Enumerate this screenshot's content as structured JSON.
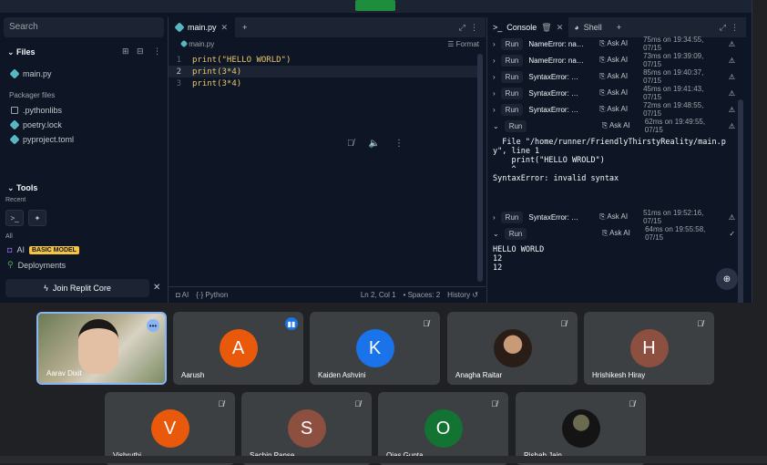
{
  "sidebar": {
    "search_placeholder": "Search",
    "files_title": "Files",
    "files": [
      "main.py"
    ],
    "packager_title": "Packager files",
    "packager_files": [
      ".pythonlibs",
      "poetry.lock",
      "pyproject.toml"
    ],
    "tools_title": "Tools",
    "recent_label": "Recent",
    "all_label": "All",
    "ai_label": "AI",
    "ai_badge": "BASIC MODEL",
    "deployments_label": "Deployments",
    "join_label": "Join Replit Core"
  },
  "editor": {
    "tab_label": "main.py",
    "crumb": "main.py",
    "format_label": "Format",
    "lines": [
      {
        "num": "1",
        "text": "print(\"HELLO WORLD\")"
      },
      {
        "num": "2",
        "text": "print(3*4)"
      },
      {
        "num": "3",
        "text": "print(3*4)"
      }
    ],
    "status": {
      "ai": "AI",
      "lang": "Python",
      "position": "Ln 2, Col 1",
      "spaces": "Spaces: 2",
      "history": "History"
    }
  },
  "console": {
    "tab_console": "Console",
    "tab_shell": "Shell",
    "runs": [
      {
        "err": "NameError: na…",
        "time": "75ms on 19:34:55, 07/15",
        "status": "⚠"
      },
      {
        "err": "NameError: na…",
        "time": "73ms on 19:39:09, 07/15",
        "status": "⚠"
      },
      {
        "err": "SyntaxError: …",
        "time": "85ms on 19:40:37, 07/15",
        "status": "⚠"
      },
      {
        "err": "SyntaxError: …",
        "time": "45ms on 19:41:43, 07/15",
        "status": "⚠"
      },
      {
        "err": "SyntaxError: …",
        "time": "72ms on 19:48:55, 07/15",
        "status": "⚠"
      },
      {
        "err": "",
        "time": "62ms on 19:49:55, 07/15",
        "status": "⚠"
      }
    ],
    "run_label": "Run",
    "ask_ai": "Ask AI",
    "traceback": "  File \"/home/runner/FriendlyThirstyReality/main.p\ny\", line 1\n    print(\"HELLO WROLD\")\n    ^\nSyntaxError: invalid syntax",
    "run7": {
      "err": "SyntaxError: …",
      "time": "51ms on 19:52:16, 07/15",
      "status": "⚠"
    },
    "run8": {
      "err": "",
      "time": "64ms on 19:55:58, 07/15",
      "status": "✓"
    },
    "output": "HELLO WORLD\n12\n12"
  },
  "meeting": {
    "participants": [
      {
        "name": "Aarav Dixit",
        "initial": "",
        "color": "#5b6a56"
      },
      {
        "name": "Aarush",
        "initial": "A",
        "color": "#e8590c"
      },
      {
        "name": "Kaiden Ashvini",
        "initial": "K",
        "color": "#1a73e8"
      },
      {
        "name": "Anagha Raitar",
        "initial": "",
        "color": "#3c4043"
      },
      {
        "name": "Hrishikesh Hiray",
        "initial": "H",
        "color": "#8d4f3f"
      },
      {
        "name": "Vishruthi",
        "initial": "V",
        "color": "#e8590c"
      },
      {
        "name": "Sachin Panse",
        "initial": "S",
        "color": "#8d4f3f"
      },
      {
        "name": "Ojas Gupta",
        "initial": "O",
        "color": "#137333"
      },
      {
        "name": "Rishab Jain",
        "initial": "",
        "color": "#3c4043"
      }
    ]
  }
}
